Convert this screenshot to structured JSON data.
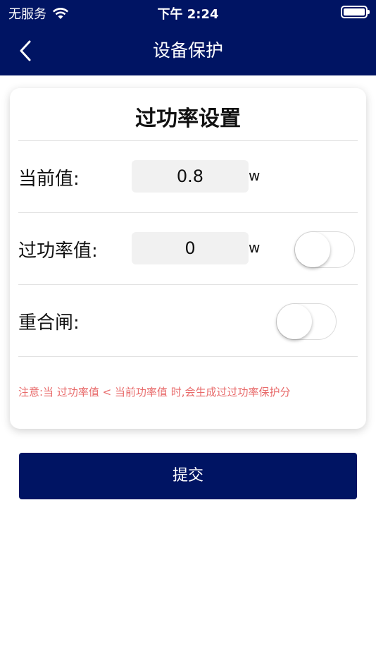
{
  "status_bar": {
    "carrier": "无服务",
    "time": "下午 2:24"
  },
  "nav": {
    "title": "设备保护",
    "back_icon": "chevron-left-icon"
  },
  "card": {
    "title": "过功率设置",
    "current_value": {
      "label": "当前值:",
      "value": "0.8",
      "unit": "w"
    },
    "overpower_value": {
      "label": "过功率值:",
      "value": "0",
      "unit": "w",
      "toggle_on": false
    },
    "reclose": {
      "label": "重合闸:",
      "toggle_on": false
    },
    "note": "注意:当 过功率值 < 当前功率值 时,会生成过过功率保护分"
  },
  "submit_label": "提交",
  "colors": {
    "primary": "#001463",
    "note": "#e86a6a"
  }
}
